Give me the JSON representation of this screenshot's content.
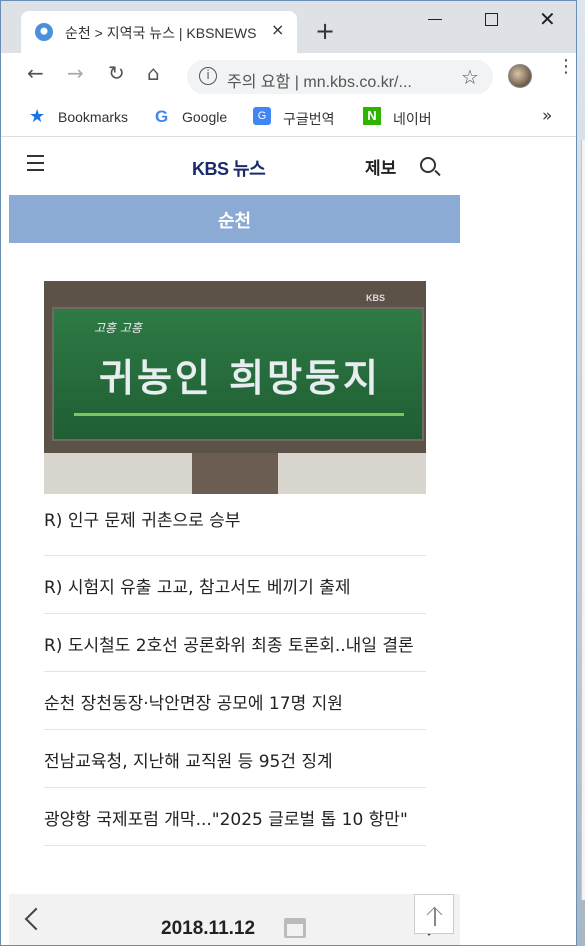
{
  "browser": {
    "tab_title": "순천 > 지역국 뉴스 | KBSNEWS",
    "tab_close": "×",
    "new_tab": "+",
    "window_close": "✕",
    "nav_back": "←",
    "nav_forward": "→",
    "nav_reload": "↻",
    "nav_home": "⌂",
    "address_info": "i",
    "address_text": "주의 요함 | mn.kbs.co.kr/...",
    "bookmark_star": "☆",
    "menu_dots": "⋮",
    "bookmarks": [
      {
        "label": "Bookmarks",
        "icon": "star-icon"
      },
      {
        "label": "Google",
        "icon": "google-icon"
      },
      {
        "label": "구글번역",
        "icon": "google-translate-icon"
      },
      {
        "label": "네이버",
        "icon": "naver-icon"
      }
    ],
    "bookmarks_more": "»",
    "google_glyph": "G",
    "translate_glyph": "G",
    "naver_glyph": "N"
  },
  "site": {
    "logo": "KBS 뉴스",
    "report_label": "제보",
    "region": "순천",
    "hero_image_label": "귀농인 희망둥지",
    "hero_image_small": "고흥 고흥",
    "hero_watermark": "KBS",
    "news": [
      "R) 인구 문제 귀촌으로 승부",
      "R) 시험지 유출 고교, 참고서도 베끼기 출제",
      "R) 도시철도 2호선 공론화위 최종 토론회..내일 결론",
      "순천 장천동장·낙안면장 공모에 17명 지원",
      "전남교육청, 지난해 교직원 등 95건 징계",
      "광양항 국제포럼 개막...\"2025 글로벌 톱 10 항만\""
    ],
    "date": "2018.11.12"
  },
  "colors": {
    "region_bar": "#8baad4",
    "logo": "#1b2a6b",
    "tab_bar": "#dee1e6"
  }
}
